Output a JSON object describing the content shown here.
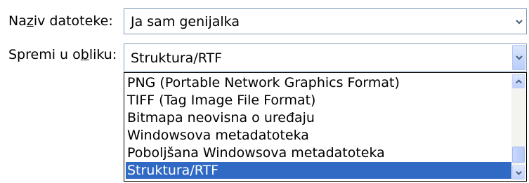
{
  "filename": {
    "label_before": "Na",
    "label_accel": "z",
    "label_after": "iv datoteke:",
    "value": "Ja sam genijalka",
    "arrow_icon": "chevron-down-icon"
  },
  "save_as": {
    "label_before": "Spremi u o",
    "label_accel": "b",
    "label_after": "liku:",
    "value": "Struktura/RTF",
    "arrow_icon": "chevron-down-icon"
  },
  "format_list": {
    "options": [
      "PNG (Portable Network Graphics Format)",
      "TIFF (Tag Image File Format)",
      "Bitmapa neovisna o uređaju",
      "Windowsova metadatoteka",
      "Poboljšana Windowsova metadatoteka",
      "Struktura/RTF"
    ],
    "selected_index": 5,
    "scroll_up_icon": "chevron-up-icon",
    "scroll_down_icon": "chevron-down-icon"
  },
  "colors": {
    "selection": "#316ac5",
    "selection_text": "#ffffff",
    "arrow": "#4d6185",
    "field_border": "#7f9db9"
  }
}
